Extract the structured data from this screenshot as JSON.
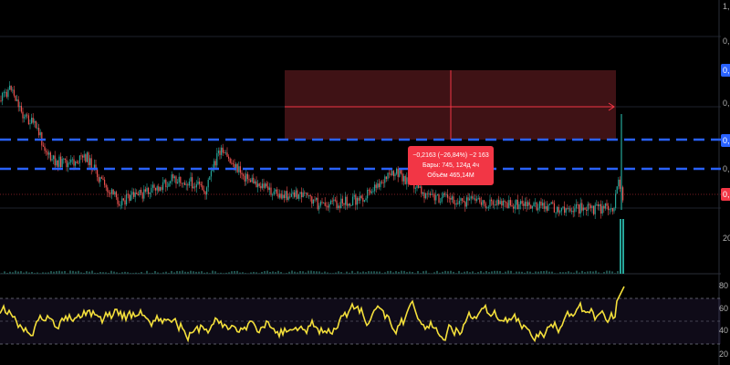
{
  "chart": {
    "price_axis_labels": [
      "1,",
      "0,",
      "0,",
      "0,",
      "20"
    ],
    "price_tags": [
      {
        "text": "0,",
        "color": "#2962ff"
      },
      {
        "text": "0,",
        "color": "#2962ff"
      },
      {
        "text": "0,",
        "color": "#f23645"
      }
    ],
    "measure_tooltip": {
      "line1": "−0,2163 (−26,84%) −2 163",
      "line2": "Бары: 745, 124д 4ч",
      "line3": "Объём 465,14M"
    },
    "rsi_axis_labels": [
      "80",
      "60",
      "40",
      "20"
    ],
    "colors": {
      "background": "#000000",
      "up": "#26a69a",
      "down": "#ef5350",
      "rsi_line": "#f5e03b",
      "dashed_level": "#2962ff",
      "measure_box": "#5a1a1e",
      "measure_line": "#f23645"
    }
  }
}
